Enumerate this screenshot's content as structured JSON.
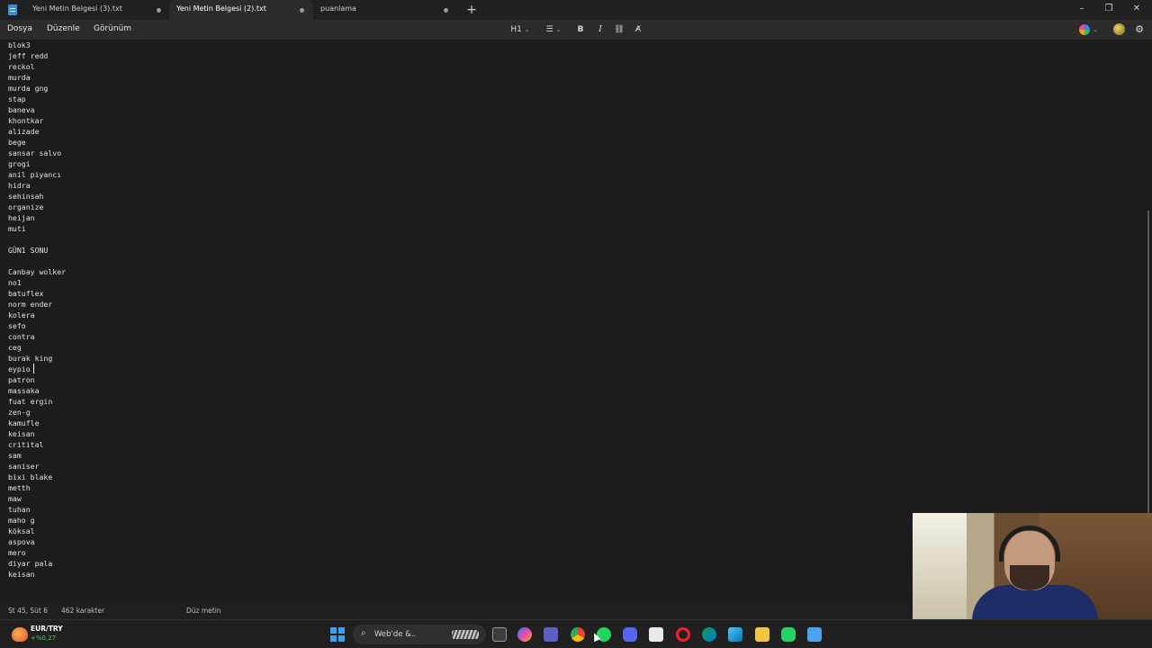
{
  "tabs": [
    {
      "label": "Yeni Metin Belgesi (3).txt",
      "active": false
    },
    {
      "label": "Yeni Metin Belgesi (2).txt",
      "active": true
    },
    {
      "label": "puanlama",
      "active": false
    }
  ],
  "new_tab_symbol": "+",
  "window_controls": {
    "minimize": "–",
    "maximize": "❐",
    "close": "✕"
  },
  "menu": [
    "Dosya",
    "Düzenle",
    "Görünüm"
  ],
  "toolbar": {
    "heading": "H1",
    "bold": "B",
    "italic": "I",
    "icons": [
      "heading-dropdown-icon",
      "list-icon",
      "bold-icon",
      "italic-icon",
      "link-icon",
      "clear-format-icon",
      "copilot-icon",
      "account-icon",
      "settings-icon"
    ]
  },
  "document_lines": [
    "blok3",
    "jeff redd",
    "reckol",
    "murda",
    "murda gng",
    "stap",
    "baneva",
    "khontkar",
    "alizade",
    "bege",
    "sansar salvo",
    "grogi",
    "anil piyancı",
    "hidra",
    "sehinsah",
    "organize",
    "heijan",
    "muti",
    "",
    "GÜN1 SONU",
    "",
    "Canbay wolker",
    "no1",
    "batuflex",
    "norm ender",
    "kolera",
    "sefo",
    "contra",
    "ceg",
    "burak king",
    "eypio",
    "patron",
    "massaka",
    "fuat ergin",
    "zen-g",
    "kamufle",
    "keisan",
    "critital",
    "sam",
    "saniser",
    "bixi blake",
    "metth",
    "maw",
    "tuhan",
    "maho g",
    "köksal",
    "aspova",
    "mero",
    "diyar pala",
    "keisan"
  ],
  "status": {
    "position": "St 45, Süt 6",
    "characters": "462 karakter",
    "format": "Düz metin"
  },
  "taskbar": {
    "fx_label": "EUR/TRY",
    "fx_change": "+%0,27",
    "search_text": "Web'de &..",
    "apps": [
      "start-icon",
      "search-icon",
      "task-view-icon",
      "copilot-app-icon",
      "teams-icon",
      "chrome-icon",
      "spotify-icon",
      "discord-icon",
      "snipping-tool-icon",
      "opera-icon",
      "edge-icon",
      "paint-icon",
      "file-explorer-icon",
      "whatsapp-icon",
      "notepad-icon"
    ]
  },
  "colors": {
    "background": "#1c1c1c",
    "chrome": "#2b2b2b",
    "taskbar": "#202020",
    "accent": "#3aa0f0",
    "fx_change": "#5ecb6b"
  }
}
